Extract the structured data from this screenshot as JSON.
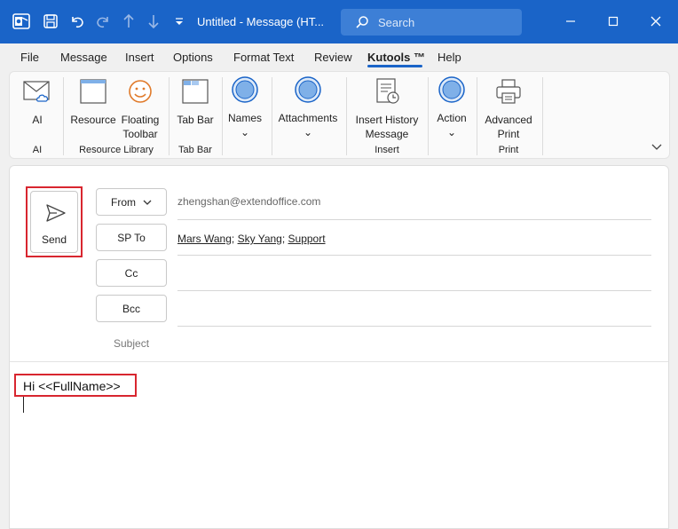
{
  "title_bar": {
    "title": "Untitled  -  Message (HT...",
    "search_placeholder": "Search"
  },
  "menu": {
    "items": [
      "File",
      "Message",
      "Insert",
      "Options",
      "Format Text",
      "Review",
      "Kutools ™",
      "Help"
    ],
    "active": "Kutools ™"
  },
  "ribbon": {
    "buttons": {
      "ai": "AI",
      "resource": "Resource",
      "floating_toolbar_1": "Floating",
      "floating_toolbar_2": "Toolbar",
      "tab_bar": "Tab Bar",
      "names": "Names",
      "attachments": "Attachments",
      "insert_history_1": "Insert History",
      "insert_history_2": "Message",
      "action": "Action",
      "advanced_print_1": "Advanced",
      "advanced_print_2": "Print"
    },
    "groups": {
      "ai": "AI",
      "resource_library": "Resource Library",
      "tab_bar": "Tab Bar",
      "insert": "Insert",
      "print": "Print"
    },
    "accent_color": "#1a64c8"
  },
  "compose": {
    "send_label": "Send",
    "from_label": "From",
    "from_value": "zhengshan@extendoffice.com",
    "to_label": "SP To",
    "recipients": [
      "Mars Wang",
      "Sky Yang",
      "Support"
    ],
    "cc_label": "Cc",
    "bcc_label": "Bcc",
    "subject_label": "Subject",
    "body_text": "Hi <<FullName>>",
    "highlight_color": "#d8262f"
  }
}
